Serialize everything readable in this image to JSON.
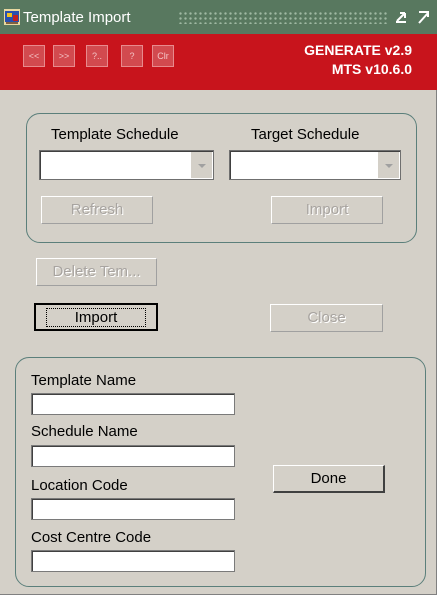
{
  "window": {
    "title": "Template Import"
  },
  "toolbar": {
    "buttons": [
      "<<",
      ">>",
      "?..",
      "?",
      "Clr"
    ],
    "version_line1": "GENERATE v2.9",
    "version_line2": "MTS v10.6.0"
  },
  "schedule_group": {
    "template_label": "Template Schedule",
    "template_value": "",
    "target_label": "Target Schedule",
    "target_value": "",
    "refresh_label": "Refresh",
    "import_label": "Import"
  },
  "actions": {
    "delete_label": "Delete Tem...",
    "import_label": "Import",
    "close_label": "Close"
  },
  "details": {
    "template_name_label": "Template Name",
    "template_name_value": "",
    "schedule_name_label": "Schedule Name",
    "schedule_name_value": "",
    "location_code_label": "Location Code",
    "location_code_value": "",
    "cost_centre_label": "Cost Centre Code",
    "cost_centre_value": "",
    "done_label": "Done"
  },
  "colors": {
    "titlebar": "#58785f",
    "toolbar": "#c8141c",
    "window": "#d4d0c8"
  }
}
